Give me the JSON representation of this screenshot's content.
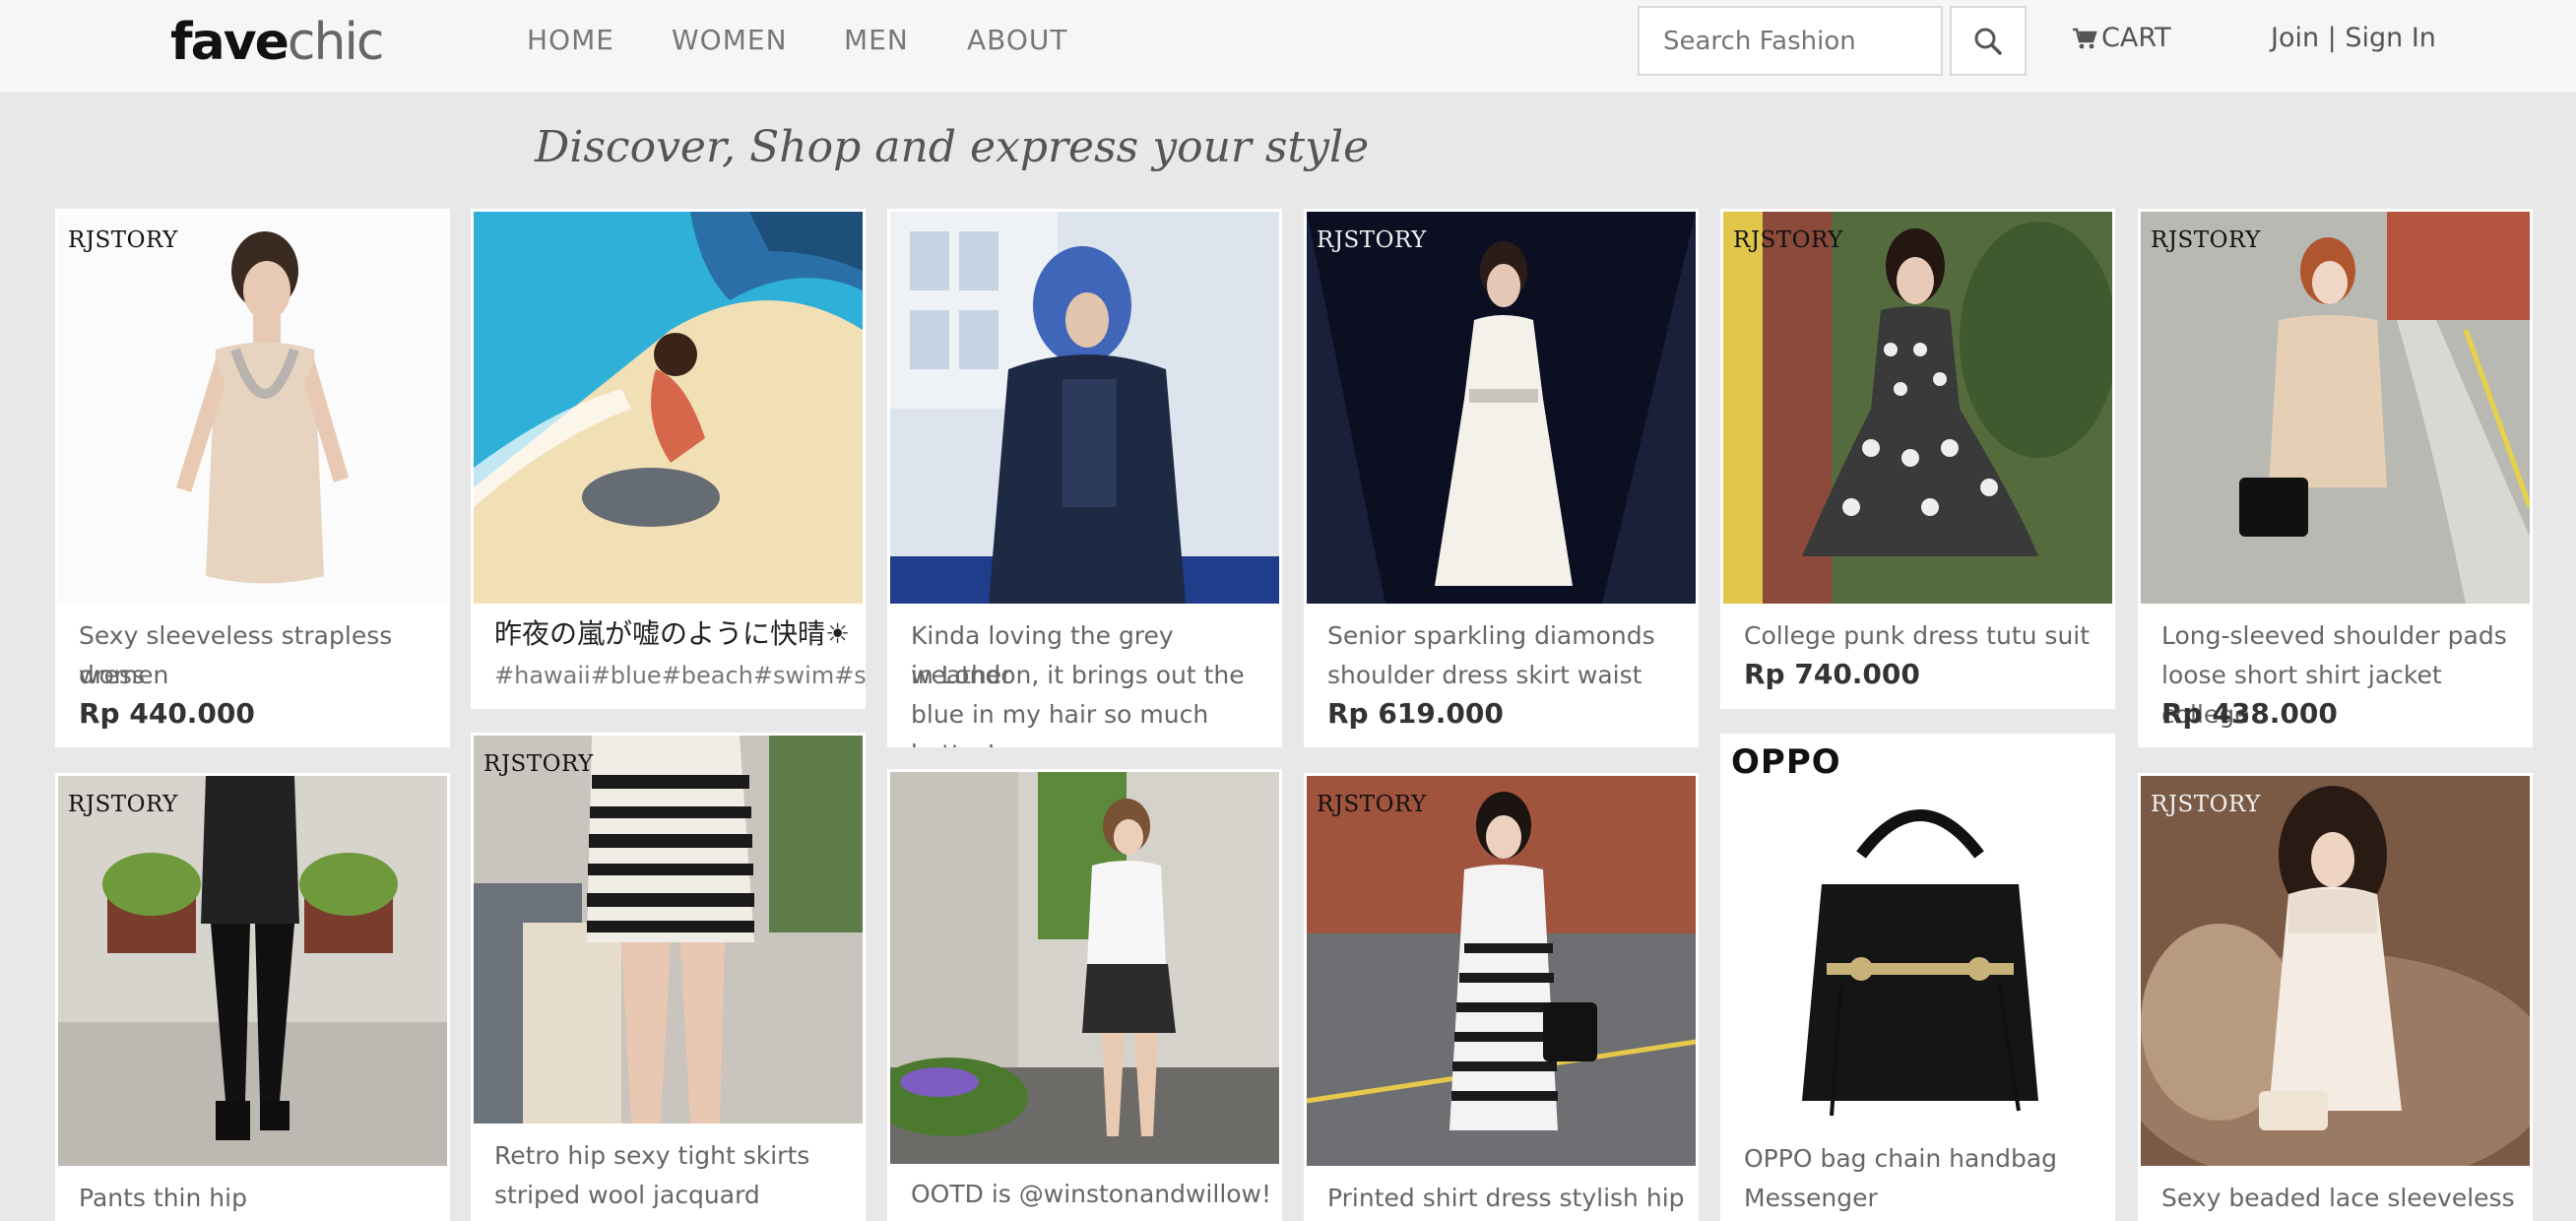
{
  "header": {
    "logo_part1": "fave",
    "logo_part2": "chic",
    "nav": [
      "HOME",
      "WOMEN",
      "MEN",
      "ABOUT"
    ],
    "search_placeholder": "Search Fashion",
    "cart_label": "CART",
    "auth_label": "Join | Sign In"
  },
  "tagline": "Discover, Shop and express your style",
  "row1": [
    {
      "brand": "RJSTORY",
      "caption1": "Sexy sleeveless strapless dress",
      "caption2": "women",
      "price": "Rp 440.000"
    },
    {
      "caption": "昨夜の嵐が嘘のように快晴☀",
      "tags": "#hawaii#blue#beach#swim#sun#se"
    },
    {
      "caption1": "Kinda loving the grey weather",
      "caption2": "in London, it brings out the",
      "caption3": "blue in my hair so much better!"
    },
    {
      "brand": "RJSTORY",
      "caption1": "Senior sparkling diamonds",
      "caption2": "shoulder dress skirt waist",
      "price": "Rp 619.000"
    },
    {
      "brand": "RJSTORY",
      "caption1": "College punk dress tutu suit",
      "price": "Rp 740.000"
    },
    {
      "brand": "RJSTORY",
      "caption1": "Long-sleeved shoulder pads",
      "caption2": "loose short shirt jacket college",
      "price": "Rp 438.000"
    }
  ],
  "row2": [
    {
      "brand": "RJSTORY",
      "caption1": "Pants thin hip"
    },
    {
      "brand": "RJSTORY",
      "caption1": "Retro hip sexy tight skirts",
      "caption2": "striped wool jacquard"
    },
    {
      "caption1": "OOTD is @winstonandwillow!"
    },
    {
      "brand": "RJSTORY",
      "caption1": "Printed shirt dress stylish hip"
    },
    {
      "brand": "OPPO",
      "caption1": "OPPO bag chain handbag",
      "caption2": "Messenger"
    },
    {
      "brand": "RJSTORY",
      "caption1": "Sexy beaded lace sleeveless"
    }
  ],
  "colors": {
    "page_bg": "#e8e8e8",
    "header_bg": "#f6f6f6",
    "card_bg": "#ffffff",
    "price": "#333333"
  },
  "icons": [
    "search-icon",
    "cart-icon"
  ]
}
